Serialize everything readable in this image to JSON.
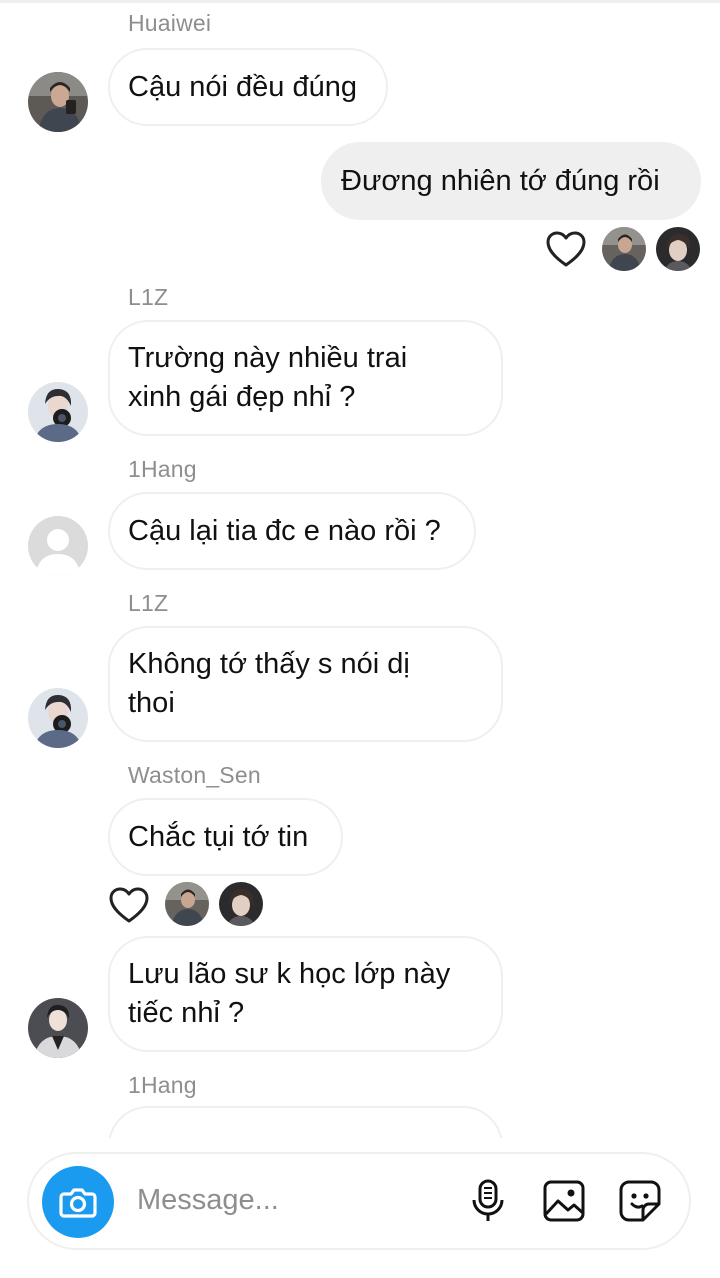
{
  "messages": [
    {
      "sender": "Huaiwei",
      "text": "Cậu nói đều đúng",
      "avatar_icon": "user-avatar-huaiwei"
    },
    {
      "text": "Đương nhiên tớ đúng rồi",
      "direction": "outgoing"
    },
    {
      "sender": "L1Z",
      "text": "Trường này nhiều trai\nxinh gái đẹp nhỉ ?",
      "avatar_icon": "user-avatar-l1z"
    },
    {
      "sender": "1Hang",
      "text": "Cậu lại tia đc e nào rồi ?",
      "avatar_icon": "default-avatar"
    },
    {
      "sender": "L1Z",
      "text": "Không tớ thấy s nói dị\nthoi",
      "avatar_icon": "user-avatar-l1z"
    },
    {
      "sender": "Waston_Sen",
      "text": "Chắc tụi tớ tin"
    },
    {
      "text": "Lưu lão sư k học lớp này\ntiếc nhỉ ?",
      "avatar_icon": "user-avatar-waston"
    },
    {
      "sender": "1Hang",
      "text": "",
      "avatar_icon": "default-avatar"
    }
  ],
  "reactions": [
    {
      "icon": "heart-outline-icon",
      "reactor_icons": [
        "reactor-avatar-1",
        "reactor-avatar-2"
      ]
    },
    {
      "icon": "heart-outline-icon",
      "reactor_icons": [
        "reactor-avatar-1",
        "reactor-avatar-2"
      ]
    }
  ],
  "composer": {
    "placeholder": "Message...",
    "icons": [
      "camera-icon",
      "microphone-icon",
      "gallery-icon",
      "sticker-icon"
    ]
  },
  "colors": {
    "accent": "#1a9bf0",
    "outgoing_bubble": "#efefef",
    "sender_text": "#8e8e8e",
    "bubble_border": "#efefef"
  }
}
